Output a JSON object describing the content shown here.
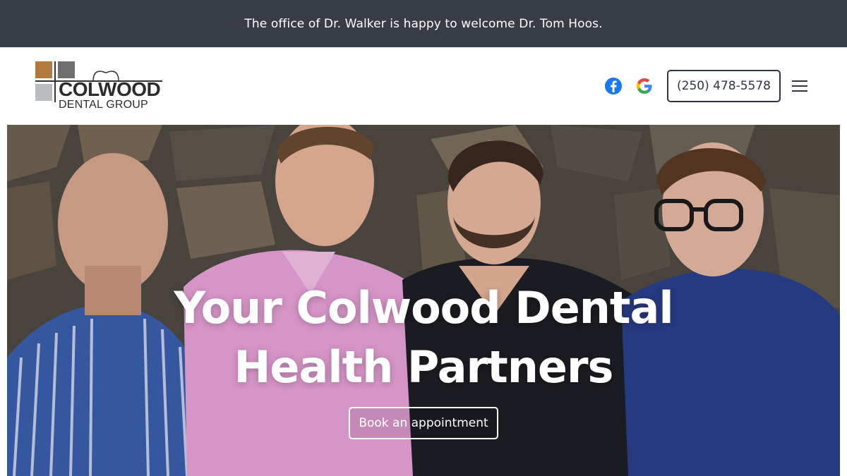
{
  "announcement": {
    "text": "The office of Dr. Walker is happy to welcome Dr. Tom Hoos."
  },
  "header": {
    "logo": {
      "line1": "COLWOOD",
      "line2": "DENTAL GROUP"
    },
    "social": [
      "facebook-icon",
      "google-icon"
    ],
    "phone_label": "(250) 478-5578",
    "menu_icon": "hamburger-menu-icon"
  },
  "hero": {
    "title_line1": "Your Colwood Dental",
    "title_line2": "Health Partners",
    "cta_label": "Book an appointment"
  },
  "colors": {
    "announcement_bg": "#383c44",
    "text_dark": "#2e3440",
    "facebook_blue": "#1877f2",
    "logo_brown": "#b07a3c"
  }
}
